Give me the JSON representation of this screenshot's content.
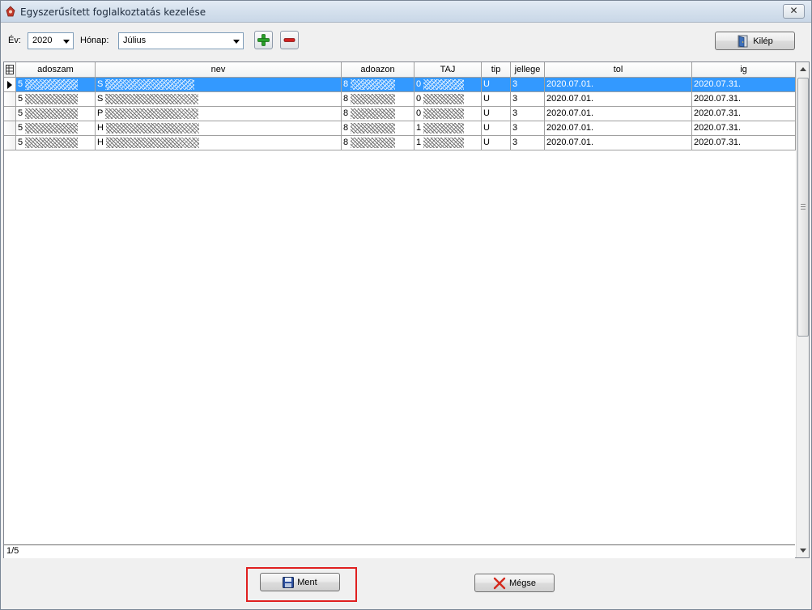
{
  "window": {
    "title": "Egyszerűsített foglalkoztatás kezelése",
    "close_glyph": "✕"
  },
  "toolbar": {
    "year_label": "Év:",
    "year_value": "2020",
    "month_label": "Hónap:",
    "month_value": "Július",
    "add_icon": "plus-icon",
    "remove_icon": "minus-icon",
    "exit_label": "Kilép"
  },
  "grid": {
    "columns": [
      "adoszam",
      "nev",
      "adoazon",
      "TAJ",
      "tip",
      "jellege",
      "tol",
      "ig"
    ],
    "rows": [
      {
        "adoszam": "5",
        "nev": "S",
        "adoazon": "8",
        "taj": "0",
        "tip": "U",
        "jellege": "3",
        "tol": "2020.07.01.",
        "ig": "2020.07.31."
      },
      {
        "adoszam": "5",
        "nev": "S",
        "adoazon": "8",
        "taj": "0",
        "tip": "U",
        "jellege": "3",
        "tol": "2020.07.01.",
        "ig": "2020.07.31."
      },
      {
        "adoszam": "5",
        "nev": "P",
        "adoazon": "8",
        "taj": "0",
        "tip": "U",
        "jellege": "3",
        "tol": "2020.07.01.",
        "ig": "2020.07.31."
      },
      {
        "adoszam": "5",
        "nev": "H",
        "adoazon": "8",
        "taj": "1",
        "tip": "U",
        "jellege": "3",
        "tol": "2020.07.01.",
        "ig": "2020.07.31."
      },
      {
        "adoszam": "5",
        "nev": "H",
        "adoazon": "8",
        "taj": "1",
        "tip": "U",
        "jellege": "3",
        "tol": "2020.07.01.",
        "ig": "2020.07.31."
      }
    ],
    "selected_row": 0,
    "record_counter": "1/5"
  },
  "footer": {
    "save_label": "Ment",
    "cancel_label": "Mégse"
  },
  "colors": {
    "selection": "#3399ff",
    "highlight_box": "#e02020",
    "add_green": "#2aa02a",
    "remove_red": "#d02020"
  }
}
